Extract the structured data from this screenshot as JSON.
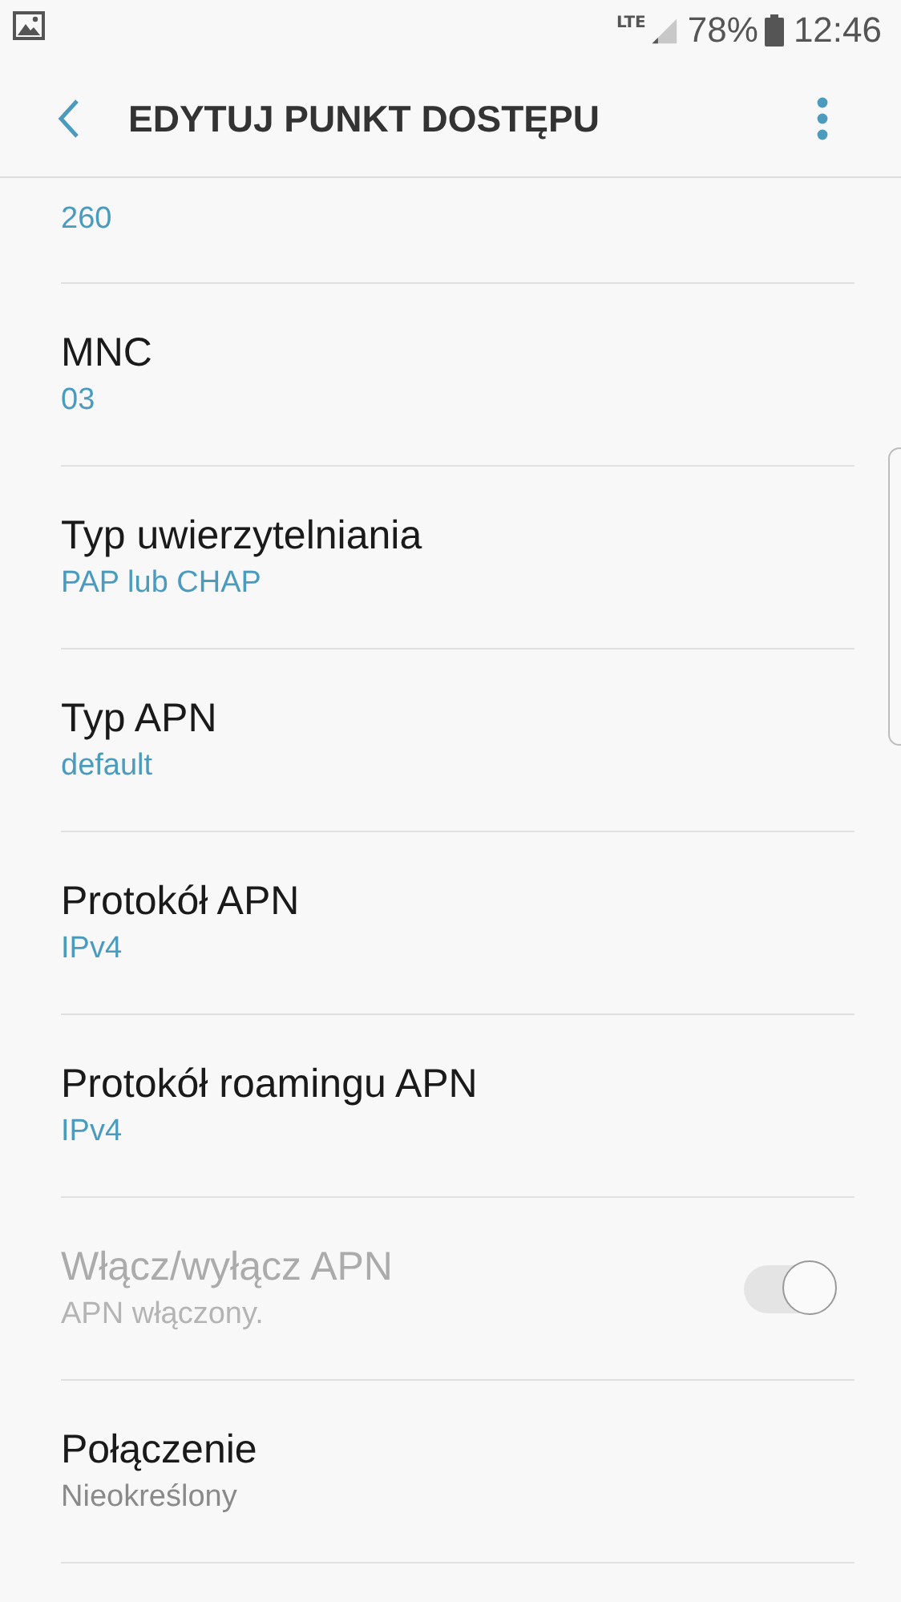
{
  "status_bar": {
    "network": "LTE",
    "battery": "78%",
    "time": "12:46"
  },
  "app_bar": {
    "title": "EDYTUJ PUNKT DOSTĘPU"
  },
  "partial_item": {
    "value": "260"
  },
  "items": [
    {
      "kind": "text",
      "title": "MNC",
      "value": "03",
      "unset": false
    },
    {
      "kind": "text",
      "title": "Typ uwierzytelniania",
      "value": "PAP lub CHAP",
      "unset": false
    },
    {
      "kind": "text",
      "title": "Typ APN",
      "value": "default",
      "unset": false
    },
    {
      "kind": "text",
      "title": "Protokół APN",
      "value": "IPv4",
      "unset": false
    },
    {
      "kind": "text",
      "title": "Protokół roamingu APN",
      "value": "IPv4",
      "unset": false
    },
    {
      "kind": "toggle",
      "title": "Włącz/wyłącz APN",
      "value": "APN włączony.",
      "disabled": true,
      "on": true
    },
    {
      "kind": "text",
      "title": "Połączenie",
      "value": "Nieokreślony",
      "unset": true
    }
  ]
}
